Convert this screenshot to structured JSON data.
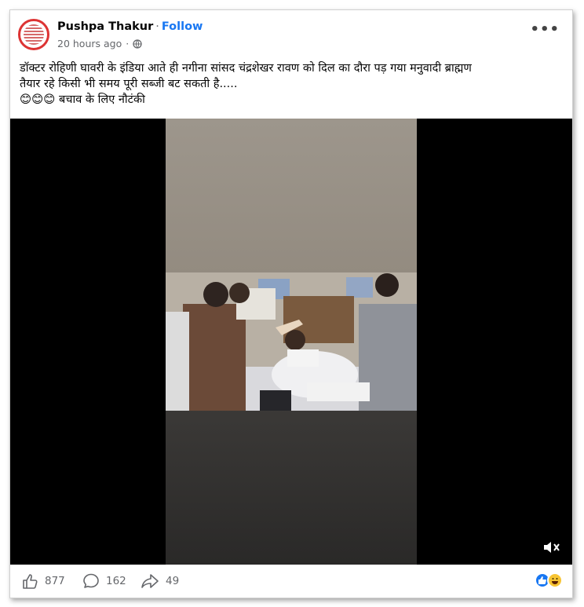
{
  "post": {
    "author": "Pushpa Thakur",
    "separator": "·",
    "follow_label": "Follow",
    "timestamp": "20 hours ago",
    "timestamp_dot": "·",
    "more_label": "•••",
    "caption_line1": "डॉक्टर रोहिणी घावरी के इंडिया आते ही नगीना सांसद चंद्रशेखर रावण को दिल का दौरा पड़ गया मनुवादी ब्राह्मण",
    "caption_line2": "तैयार रहे किसी भी समय पूरी सब्जी बट सकती है.....",
    "caption_emojis": "😊😊😊",
    "caption_line3": "बचाव के लिए नौटंकी"
  },
  "footer": {
    "likes": "877",
    "comments": "162",
    "shares": "49"
  },
  "icons": {
    "globe": "globe-icon",
    "like": "like-icon",
    "comment": "comment-icon",
    "share": "share-icon",
    "mute": "mute-icon"
  },
  "colors": {
    "accent": "#1877f2",
    "text_secondary": "#65676b"
  }
}
